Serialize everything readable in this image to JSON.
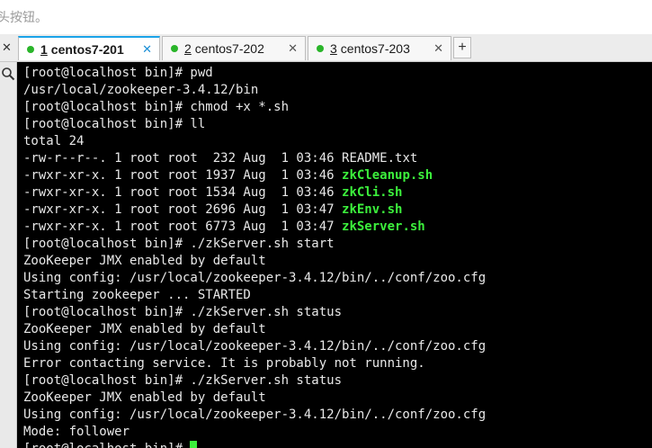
{
  "hint": {
    "text": "头按钮。"
  },
  "tabbar": {
    "left_close": "✕",
    "tabs": [
      {
        "number": "1",
        "name": "centos7-201",
        "close": "✕",
        "active": true
      },
      {
        "number": "2",
        "name": "centos7-202",
        "close": "✕",
        "active": false
      },
      {
        "number": "3",
        "name": "centos7-203",
        "close": "✕",
        "active": false
      }
    ],
    "add_label": "+"
  },
  "sidebar": {
    "icon": "search-icon"
  },
  "colors": {
    "terminal_bg": "#000000",
    "terminal_text": "#e8e8e8",
    "executable_green": "#3cf03c",
    "tab_dot_green": "#2ab52a",
    "active_tab_accent": "#1aa3e8"
  },
  "terminal": {
    "lines": [
      "[root@localhost bin]# pwd",
      "/usr/local/zookeeper-3.4.12/bin",
      "[root@localhost bin]# chmod +x *.sh",
      "[root@localhost bin]# ll",
      "total 24",
      {
        "prefix": "-rw-r--r--. 1 root root  232 Aug  1 03:46 ",
        "file": "README.txt",
        "exec": false
      },
      {
        "prefix": "-rwxr-xr-x. 1 root root 1937 Aug  1 03:46 ",
        "file": "zkCleanup.sh",
        "exec": true
      },
      {
        "prefix": "-rwxr-xr-x. 1 root root 1534 Aug  1 03:46 ",
        "file": "zkCli.sh",
        "exec": true
      },
      {
        "prefix": "-rwxr-xr-x. 1 root root 2696 Aug  1 03:47 ",
        "file": "zkEnv.sh",
        "exec": true
      },
      {
        "prefix": "-rwxr-xr-x. 1 root root 6773 Aug  1 03:47 ",
        "file": "zkServer.sh",
        "exec": true
      },
      "[root@localhost bin]# ./zkServer.sh start",
      "ZooKeeper JMX enabled by default",
      "Using config: /usr/local/zookeeper-3.4.12/bin/../conf/zoo.cfg",
      "Starting zookeeper ... STARTED",
      "[root@localhost bin]# ./zkServer.sh status",
      "ZooKeeper JMX enabled by default",
      "Using config: /usr/local/zookeeper-3.4.12/bin/../conf/zoo.cfg",
      "Error contacting service. It is probably not running.",
      "[root@localhost bin]# ./zkServer.sh status",
      "ZooKeeper JMX enabled by default",
      "Using config: /usr/local/zookeeper-3.4.12/bin/../conf/zoo.cfg",
      "Mode: follower"
    ],
    "prompt": "[root@localhost bin]# "
  }
}
